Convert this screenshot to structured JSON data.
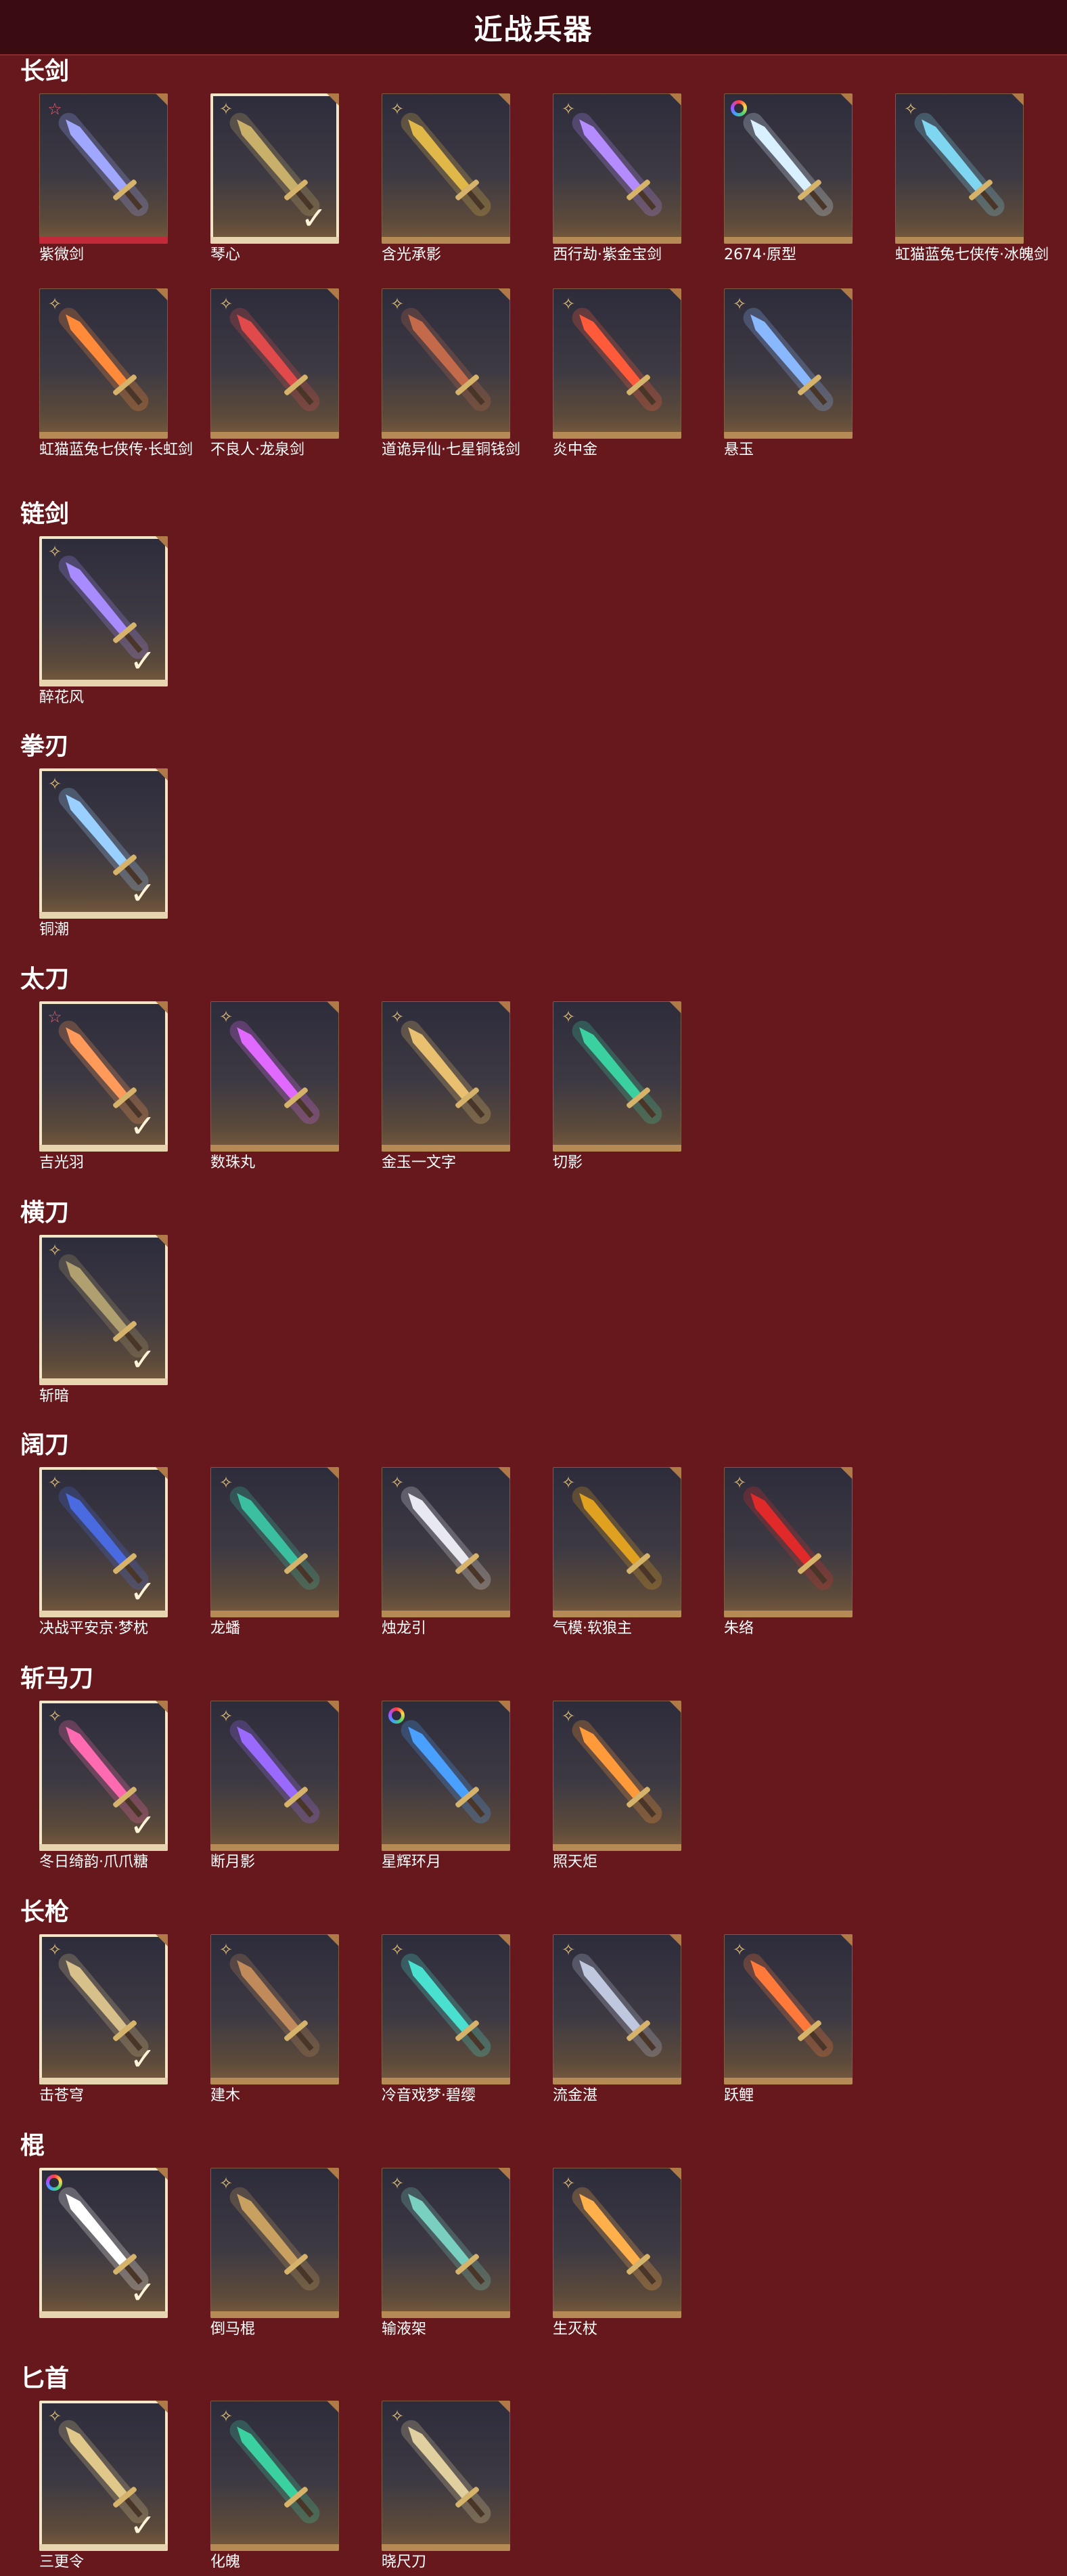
{
  "header": {
    "title": "近战兵器"
  },
  "sections": [
    {
      "title": "长剑",
      "items": [
        {
          "name": "紫微剑",
          "badge": "pink",
          "owned": false,
          "accent": "#9fa7ff",
          "redbar": true
        },
        {
          "name": "琴心",
          "badge": "star",
          "owned": true,
          "accent": "#c8b06a"
        },
        {
          "name": "含光承影",
          "badge": "star",
          "owned": false,
          "accent": "#e0b84a"
        },
        {
          "name": "西行劫·紫金宝剑",
          "badge": "star",
          "owned": false,
          "accent": "#b48cff"
        },
        {
          "name": "2674·原型",
          "badge": "ring",
          "owned": false,
          "accent": "#d8f0ff"
        },
        {
          "name": "虹猫蓝兔七侠传·冰魄剑",
          "badge": "star",
          "owned": false,
          "accent": "#7fd6f0"
        },
        {
          "name": "虹猫蓝兔七侠传·长虹剑",
          "badge": "star",
          "owned": false,
          "accent": "#ff8a3a"
        },
        {
          "name": "不良人·龙泉剑",
          "badge": "star",
          "owned": false,
          "accent": "#e04a4a"
        },
        {
          "name": "道诡异仙·七星铜钱剑",
          "badge": "star",
          "owned": false,
          "accent": "#c26a4a"
        },
        {
          "name": "炎中金",
          "badge": "star",
          "owned": false,
          "accent": "#ff5a3a"
        },
        {
          "name": "悬玉",
          "badge": "star",
          "owned": false,
          "accent": "#8ab8ff"
        }
      ]
    },
    {
      "title": "链剑",
      "items": [
        {
          "name": "醉花风",
          "badge": "star",
          "owned": true,
          "accent": "#a88cff"
        }
      ]
    },
    {
      "title": "拳刃",
      "items": [
        {
          "name": "铜潮",
          "badge": "star",
          "owned": true,
          "accent": "#9ad0ff"
        }
      ]
    },
    {
      "title": "太刀",
      "items": [
        {
          "name": "吉光羽",
          "badge": "pink",
          "owned": true,
          "accent": "#ff9a5a"
        },
        {
          "name": "数珠丸",
          "badge": "star",
          "owned": false,
          "accent": "#e06aff"
        },
        {
          "name": "金玉一文字",
          "badge": "star",
          "owned": false,
          "accent": "#e8c070"
        },
        {
          "name": "切影",
          "badge": "star",
          "owned": false,
          "accent": "#3ad0a0"
        }
      ]
    },
    {
      "title": "横刀",
      "items": [
        {
          "name": "斩暗",
          "badge": "star",
          "owned": true,
          "accent": "#b0a070"
        }
      ]
    },
    {
      "title": "阔刀",
      "items": [
        {
          "name": "决战平安京·梦枕",
          "badge": "star",
          "owned": true,
          "accent": "#4a6ae0"
        },
        {
          "name": "龙蟠",
          "badge": "star",
          "owned": false,
          "accent": "#3ac0a0"
        },
        {
          "name": "烛龙引",
          "badge": "star",
          "owned": false,
          "accent": "#e8e8f0"
        },
        {
          "name": "气模·软狼主",
          "badge": "star",
          "owned": false,
          "accent": "#e0a020"
        },
        {
          "name": "朱络",
          "badge": "star",
          "owned": false,
          "accent": "#e02a2a"
        }
      ]
    },
    {
      "title": "斩马刀",
      "items": [
        {
          "name": "冬日绮韵·爪爪糖",
          "badge": "star",
          "owned": true,
          "accent": "#ff6ab0"
        },
        {
          "name": "断月影",
          "badge": "star",
          "owned": false,
          "accent": "#9a6aff"
        },
        {
          "name": "星辉环月",
          "badge": "ring",
          "owned": false,
          "accent": "#4aa0ff"
        },
        {
          "name": "照天炬",
          "badge": "star",
          "owned": false,
          "accent": "#ff9a3a"
        }
      ]
    },
    {
      "title": "长枪",
      "items": [
        {
          "name": "击苍穹",
          "badge": "star",
          "owned": true,
          "accent": "#d8c08a"
        },
        {
          "name": "建木",
          "badge": "star",
          "owned": false,
          "accent": "#c08a5a"
        },
        {
          "name": "冷音戏梦·碧缨",
          "badge": "star",
          "owned": false,
          "accent": "#4ae0d0"
        },
        {
          "name": "流金湛",
          "badge": "star",
          "owned": false,
          "accent": "#c0c8e0"
        },
        {
          "name": "跃鲤",
          "badge": "star",
          "owned": false,
          "accent": "#ff7a3a"
        }
      ]
    },
    {
      "title": "棍",
      "items": [
        {
          "name": "",
          "badge": "ring",
          "owned": true,
          "accent": "#ffffff"
        },
        {
          "name": "倒马棍",
          "badge": "star",
          "owned": false,
          "accent": "#c8a060"
        },
        {
          "name": "输液架",
          "badge": "star",
          "owned": false,
          "accent": "#7ad0c0"
        },
        {
          "name": "生灭杖",
          "badge": "star",
          "owned": false,
          "accent": "#ffb04a"
        }
      ]
    },
    {
      "title": "匕首",
      "items": [
        {
          "name": "三更令",
          "badge": "star",
          "owned": true,
          "accent": "#e0c88a"
        },
        {
          "name": "化魄",
          "badge": "star",
          "owned": false,
          "accent": "#3ad0a0"
        },
        {
          "name": "晓尺刀",
          "badge": "star",
          "owned": false,
          "accent": "#e0d0a0"
        }
      ]
    }
  ]
}
